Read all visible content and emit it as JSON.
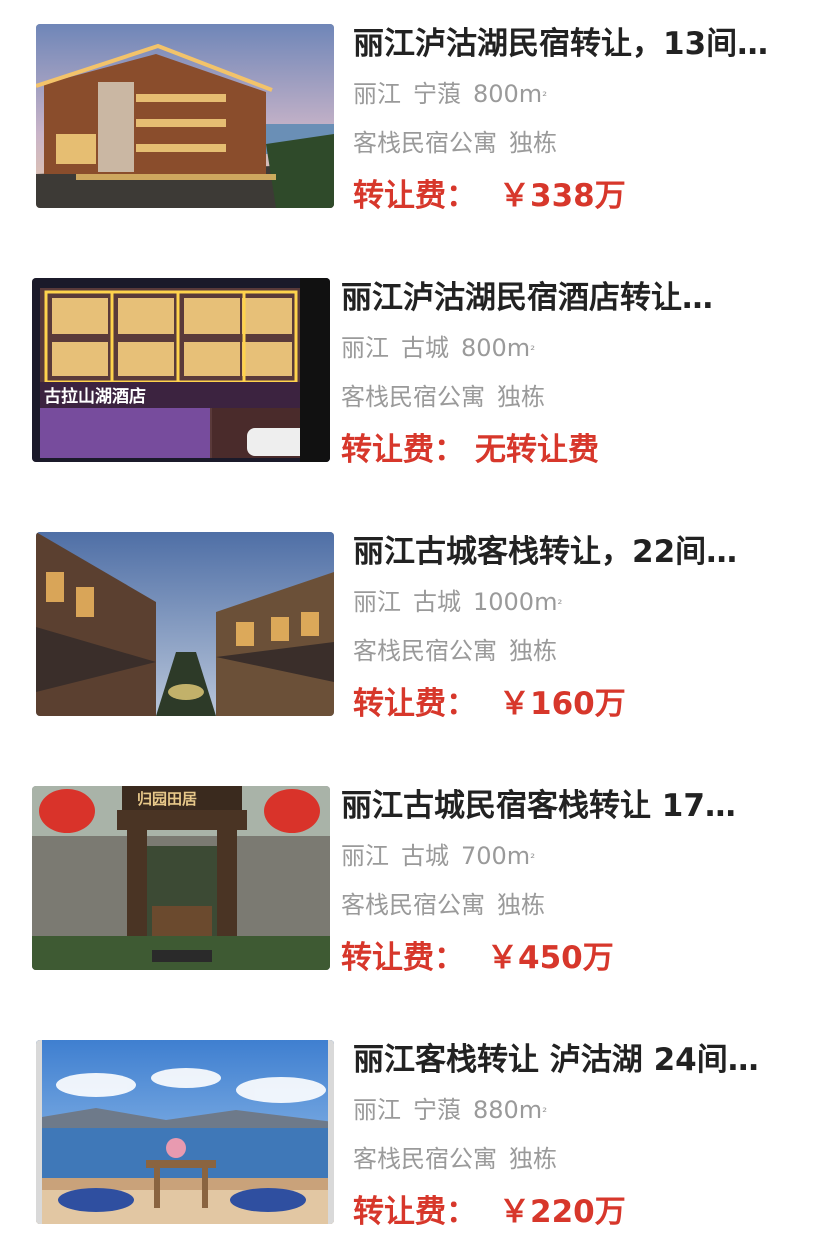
{
  "listings": [
    {
      "title": "丽江泸沽湖民宿转让，13间…",
      "city": "丽江",
      "district": "宁蒗",
      "area": "800m",
      "area_unit_mark": "²",
      "category": "客栈民宿公寓",
      "building": "独栋",
      "fee_label": "转让费：",
      "fee_value": "￥338万",
      "image_icon": "hotel-building-dusk-photo"
    },
    {
      "title": "丽江泸沽湖民宿酒店转让…",
      "city": "丽江",
      "district": "古城",
      "area": "800m",
      "area_unit_mark": "²",
      "category": "客栈民宿公寓",
      "building": "独栋",
      "fee_label": "转让费：",
      "fee_value": "无转让费",
      "image_icon": "hotel-night-lights-photo",
      "image_sign": "古拉山湖酒店"
    },
    {
      "title": "丽江古城客栈转让，22间…",
      "city": "丽江",
      "district": "古城",
      "area": "1000m",
      "area_unit_mark": "²",
      "category": "客栈民宿公寓",
      "building": "独栋",
      "fee_label": "转让费：",
      "fee_value": "￥160万",
      "image_icon": "courtyard-inn-photo"
    },
    {
      "title": "丽江古城民宿客栈转让 17…",
      "city": "丽江",
      "district": "古城",
      "area": "700m",
      "area_unit_mark": "²",
      "category": "客栈民宿公寓",
      "building": "独栋",
      "fee_label": "转让费：",
      "fee_value": "￥450万",
      "image_icon": "inn-gate-lanterns-photo",
      "image_sign": "归园田居"
    },
    {
      "title": "丽江客栈转让 泸沽湖 24间…",
      "city": "丽江",
      "district": "宁蒗",
      "area": "880m",
      "area_unit_mark": "²",
      "category": "客栈民宿公寓",
      "building": "独栋",
      "fee_label": "转让费：",
      "fee_value": "￥220万",
      "image_icon": "lake-view-terrace-photo"
    }
  ],
  "colors": {
    "title": "#222222",
    "meta": "#9a9a9a",
    "price": "#d7372b"
  }
}
